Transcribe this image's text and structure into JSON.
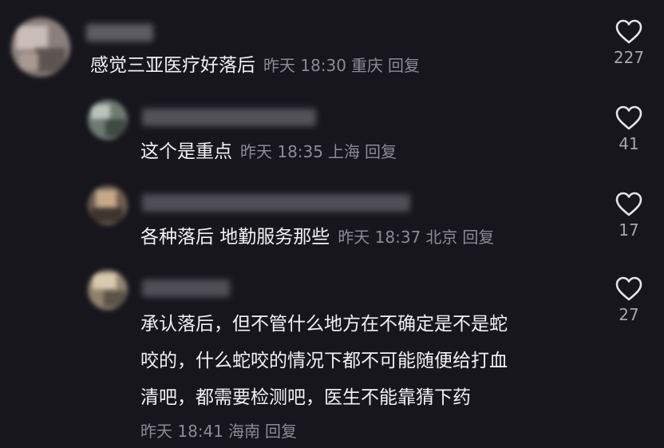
{
  "comments": [
    {
      "text": "感觉三亚医疗好落后",
      "time": "昨天 18:30",
      "location": "重庆",
      "reply": "回复",
      "likes": "227"
    },
    {
      "text": "这个是重点",
      "time": "昨天 18:35",
      "location": "上海",
      "reply": "回复",
      "likes": "41"
    },
    {
      "text": "各种落后 地勤服务那些",
      "time": "昨天 18:37",
      "location": "北京",
      "reply": "回复",
      "likes": "17"
    },
    {
      "lines": [
        "承认落后，但不管什么地方在不确定是不是蛇",
        "咬的，什么蛇咬的情况下都不可能随便给打血",
        "清吧，都需要检测吧，医生不能靠猜下药"
      ],
      "time": "昨天 18:41",
      "location": "海南",
      "reply": "回复",
      "likes": "27"
    }
  ],
  "icons": {
    "like": "heart-outline-icon"
  }
}
